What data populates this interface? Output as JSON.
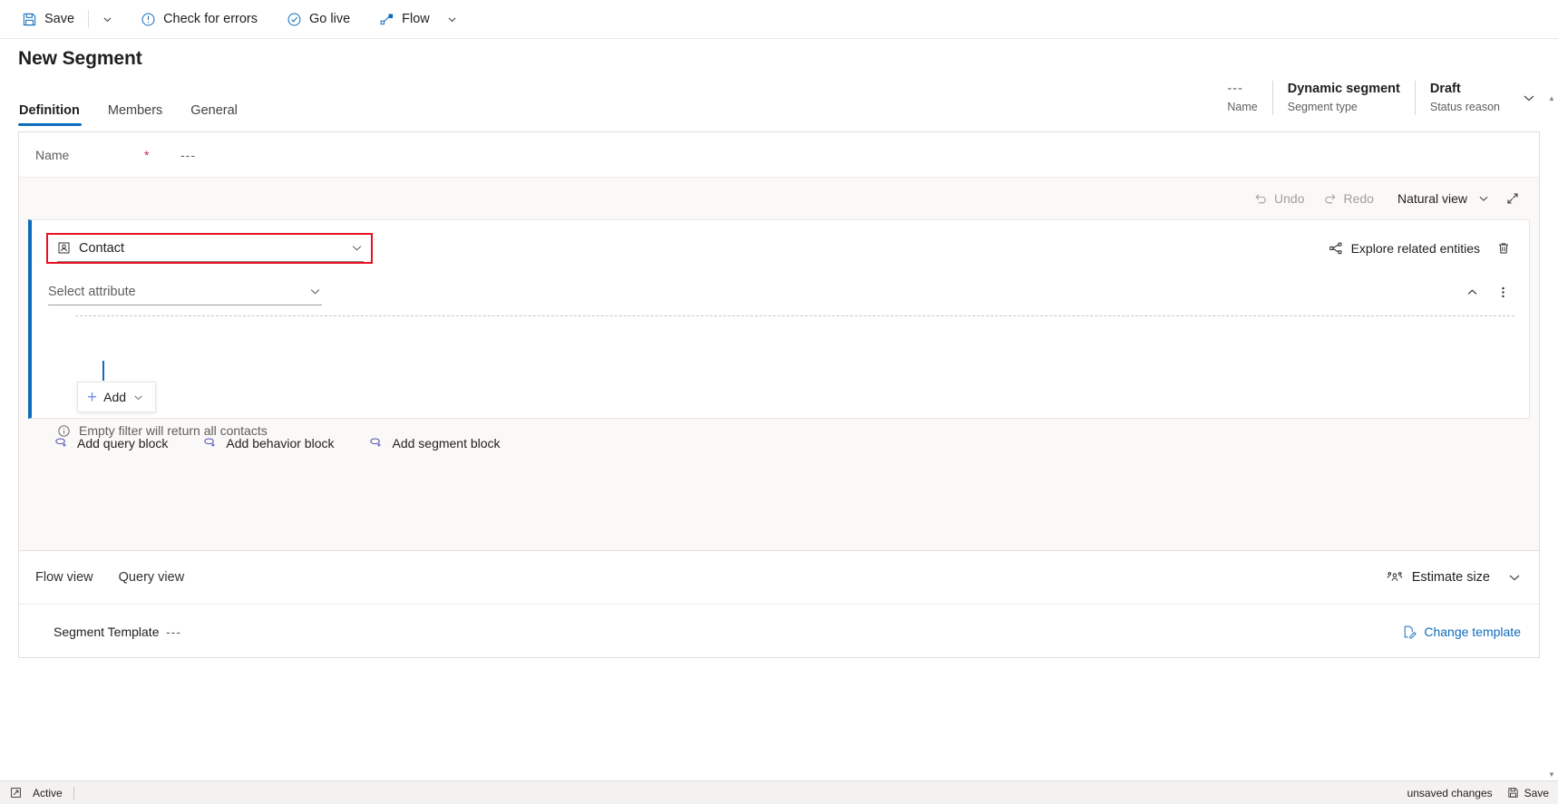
{
  "commandbar": {
    "save_label": "Save",
    "save_icon": "save-icon",
    "save_caret_icon": "chevron-down-icon",
    "check_errors_label": "Check for errors",
    "check_errors_icon": "error-circle-icon",
    "go_live_label": "Go live",
    "go_live_icon": "check-circle-icon",
    "flow_label": "Flow",
    "flow_icon": "flow-icon",
    "flow_caret_icon": "chevron-down-icon"
  },
  "header": {
    "title": "New Segment",
    "fields": [
      {
        "value": "---",
        "label": "Name",
        "muted": true
      },
      {
        "value": "Dynamic segment",
        "label": "Segment type",
        "muted": false
      },
      {
        "value": "Draft",
        "label": "Status reason",
        "muted": false
      }
    ],
    "caret_icon": "chevron-down-icon"
  },
  "tabs": [
    {
      "label": "Definition",
      "active": true
    },
    {
      "label": "Members",
      "active": false
    },
    {
      "label": "General",
      "active": false
    }
  ],
  "name_row": {
    "label": "Name",
    "required_marker": "*",
    "value": "---"
  },
  "canvas_toolbar": {
    "undo_label": "Undo",
    "undo_icon": "undo-icon",
    "redo_label": "Redo",
    "redo_icon": "redo-icon",
    "view_mode_label": "Natural view",
    "view_mode_caret_icon": "chevron-down-icon",
    "expand_icon": "expand-diagonal-icon"
  },
  "block": {
    "entity_value": "Contact",
    "entity_icon": "contact-entity-icon",
    "entity_caret_icon": "chevron-down-icon",
    "highlight_color": "#e81123",
    "accent_color": "#0f6cbd",
    "explore_label": "Explore related entities",
    "explore_icon": "share-nodes-icon",
    "delete_icon": "trash-icon",
    "attribute_placeholder": "Select attribute",
    "attribute_caret_icon": "chevron-down-icon",
    "collapse_icon": "chevron-up-icon",
    "more_icon": "more-vertical-icon",
    "add_label": "Add",
    "add_icon": "plus-icon",
    "add_caret_icon": "chevron-down-icon",
    "hint_text": "Empty filter will return all contacts",
    "hint_icon": "info-circle-icon"
  },
  "block_actions": [
    {
      "label": "Add query block",
      "icon": "add-query-block-icon"
    },
    {
      "label": "Add behavior block",
      "icon": "add-behavior-block-icon"
    },
    {
      "label": "Add segment block",
      "icon": "add-segment-block-icon"
    }
  ],
  "lower": {
    "views": [
      {
        "label": "Flow view"
      },
      {
        "label": "Query view"
      }
    ],
    "estimate_label": "Estimate size",
    "estimate_icon": "people-icon",
    "estimate_caret_icon": "chevron-down-icon",
    "template_label": "Segment Template",
    "template_value": "---",
    "change_template_label": "Change template",
    "change_template_icon": "edit-document-icon"
  },
  "statusbar": {
    "left_icon": "expand-window-icon",
    "active_label": "Active",
    "unsaved_label": "unsaved changes",
    "save_label": "Save",
    "save_icon": "save-icon"
  }
}
